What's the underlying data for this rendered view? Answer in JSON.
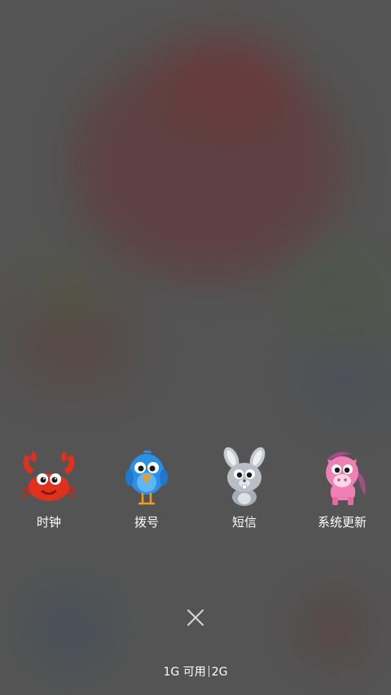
{
  "recent_apps": [
    {
      "label": "时钟",
      "icon": "crab-icon",
      "color": "#e0301e"
    },
    {
      "label": "拨号",
      "icon": "bird-icon",
      "color": "#2b8fe8"
    },
    {
      "label": "短信",
      "icon": "rabbit-icon",
      "color": "#b9bec6"
    },
    {
      "label": "系统更新",
      "icon": "pony-icon",
      "color": "#f07fb6"
    }
  ],
  "close_icon": "close-icon",
  "memory": {
    "available": "1G 可用",
    "total": "2G"
  }
}
